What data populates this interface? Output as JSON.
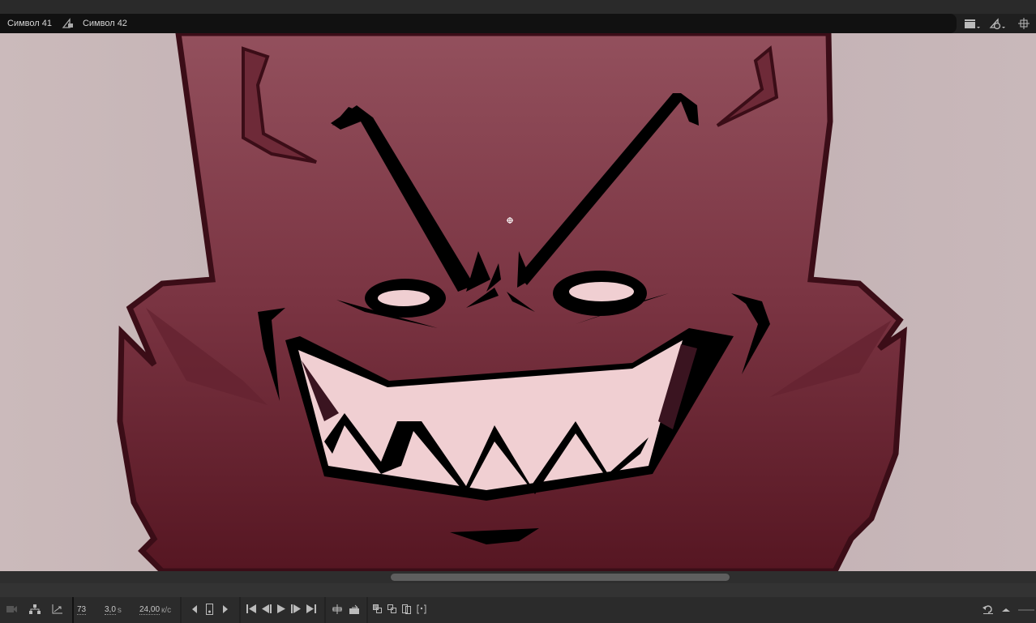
{
  "breadcrumb": {
    "items": [
      {
        "label": "Символ 41",
        "icon": "graphic-symbol-icon"
      },
      {
        "label": "Символ 42"
      }
    ]
  },
  "toolbar_right": {
    "icons": [
      "scene-clapper-icon",
      "symbol-edit-icon",
      "center-stage-icon"
    ]
  },
  "timeline": {
    "frame": "73",
    "time": "3,0",
    "time_unit": "s",
    "fps": "24,00",
    "fps_unit": "к/с",
    "icons": [
      "camera-icon",
      "layer-parenting-icon",
      "graph-icon",
      "prev-keyframe-icon",
      "add-keyframe-icon",
      "next-keyframe-icon",
      "first-frame-icon",
      "step-back-icon",
      "play-icon",
      "step-forward-icon",
      "last-frame-icon",
      "loop-icon",
      "onion-skin-icon",
      "onion-outline-icon",
      "edit-multiple-icon",
      "onion-range-icon",
      "undo-icon",
      "zoom-out-icon"
    ]
  },
  "colors": {
    "accent_bg": "#2b2b2b",
    "skin": "#7d3a48",
    "outline": "#3b0d17",
    "teeth": "#f0cfd2"
  }
}
